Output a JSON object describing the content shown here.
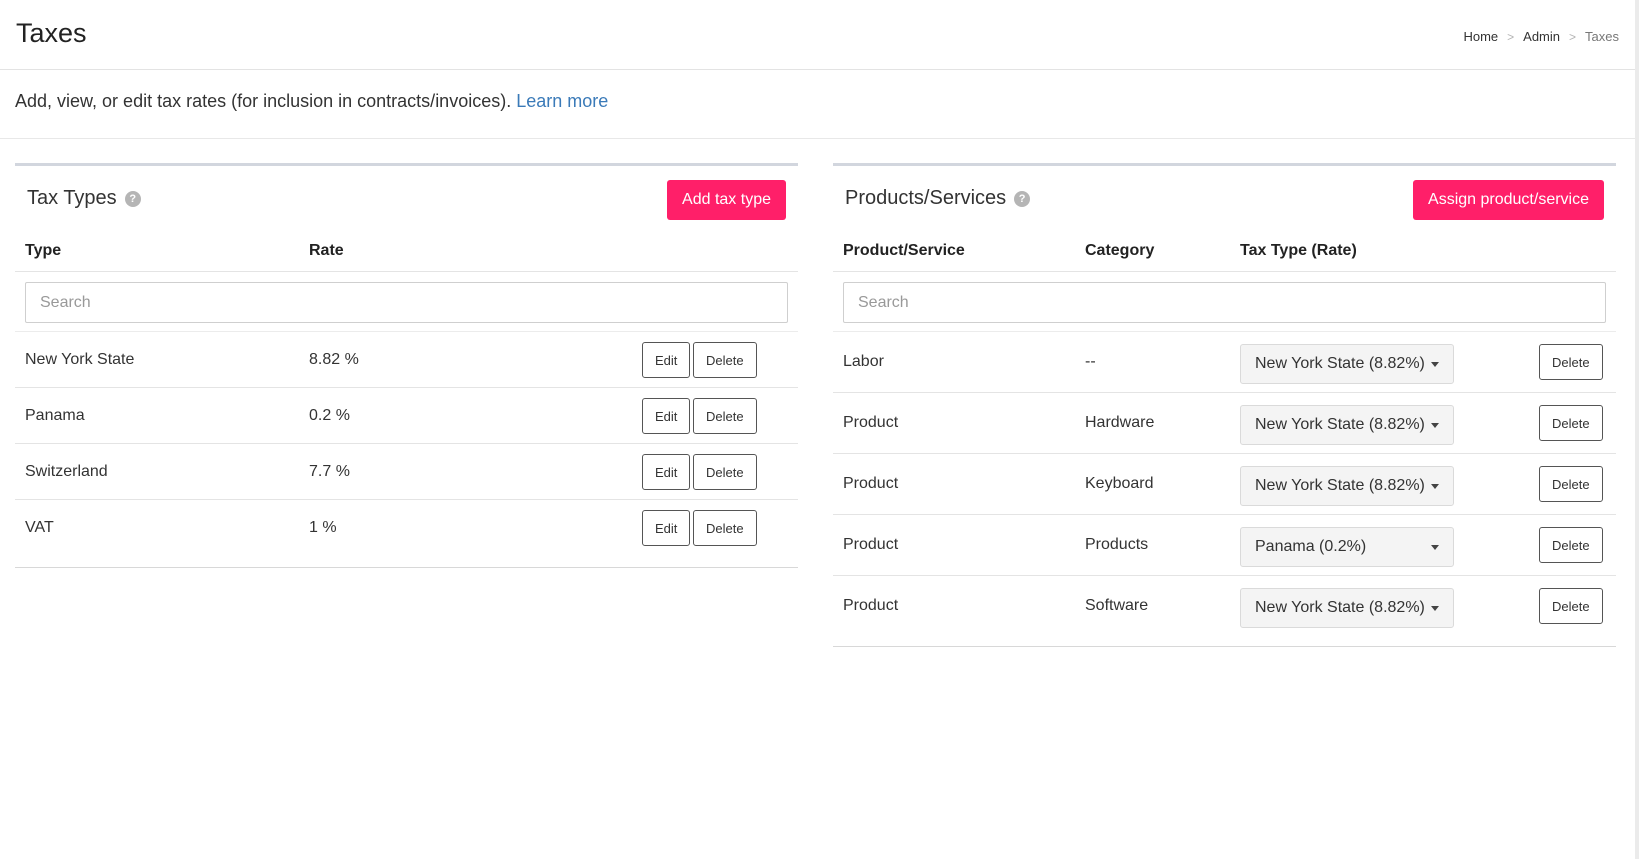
{
  "header": {
    "title": "Taxes",
    "breadcrumb": {
      "home": "Home",
      "admin": "Admin",
      "current": "Taxes",
      "separator": ">"
    }
  },
  "intro": {
    "text": "Add, view, or edit tax rates (for inclusion in contracts/invoices).",
    "link_label": "Learn more"
  },
  "tax_types": {
    "title": "Tax Types",
    "help_glyph": "?",
    "add_button": "Add tax type",
    "columns": {
      "type": "Type",
      "rate": "Rate"
    },
    "search_placeholder": "Search",
    "edit_label": "Edit",
    "delete_label": "Delete",
    "rows": [
      {
        "type": "New York State",
        "rate": "8.82 %"
      },
      {
        "type": "Panama",
        "rate": "0.2 %"
      },
      {
        "type": "Switzerland",
        "rate": "7.7 %"
      },
      {
        "type": "VAT",
        "rate": "1 %"
      }
    ]
  },
  "products": {
    "title": "Products/Services",
    "help_glyph": "?",
    "assign_button": "Assign product/service",
    "columns": {
      "product": "Product/Service",
      "category": "Category",
      "tax_type": "Tax Type (Rate)"
    },
    "search_placeholder": "Search",
    "delete_label": "Delete",
    "rows": [
      {
        "product": "Labor",
        "category": "--",
        "tax_type": "New York State (8.82%)"
      },
      {
        "product": "Product",
        "category": "Hardware",
        "tax_type": "New York State (8.82%)"
      },
      {
        "product": "Product",
        "category": "Keyboard",
        "tax_type": "New York State (8.82%)"
      },
      {
        "product": "Product",
        "category": "Products",
        "tax_type": "Panama (0.2%)"
      },
      {
        "product": "Product",
        "category": "Software",
        "tax_type": "New York State (8.82%)"
      }
    ]
  },
  "colors": {
    "accent": "#ff1f69",
    "link": "#3a7ab8",
    "panel_border": "#d2d6de"
  }
}
